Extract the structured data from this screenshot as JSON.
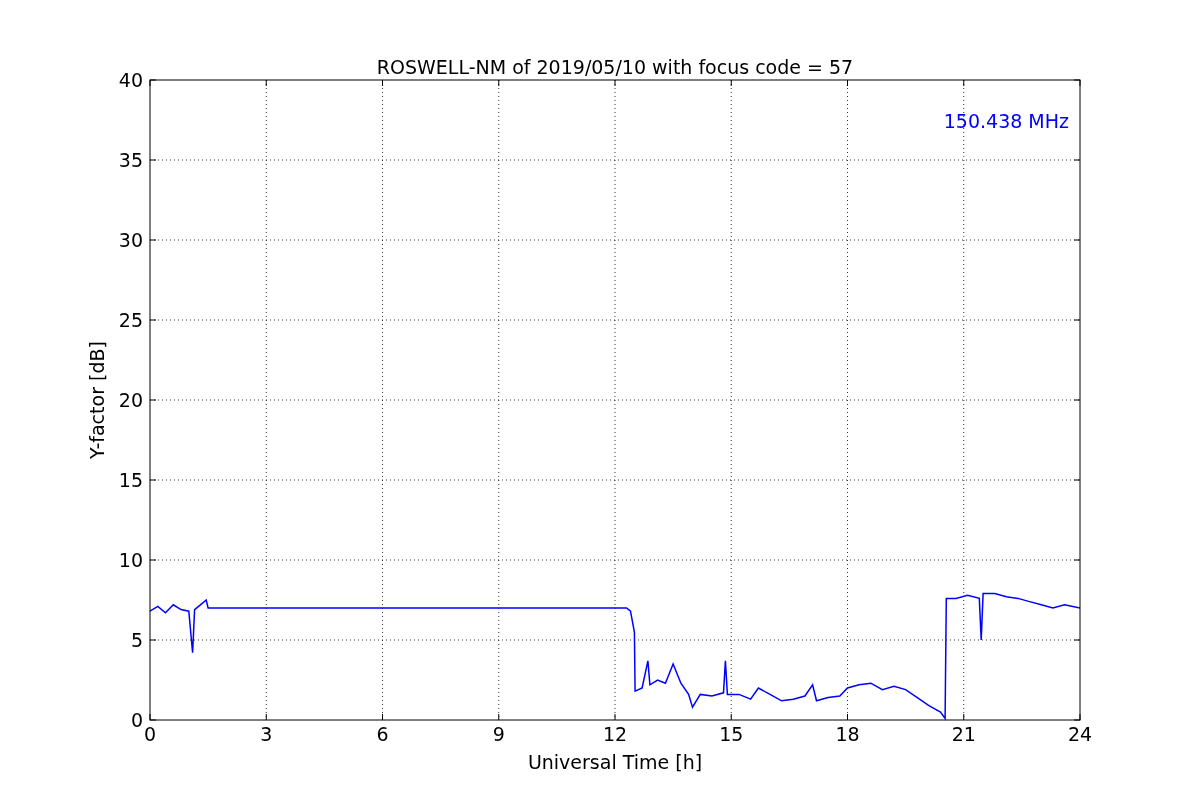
{
  "figure": {
    "chart_data": {
      "type": "line",
      "title": "ROSWELL-NM of 2019/05/10 with focus code = 57",
      "xlabel": "Universal Time [h]",
      "ylabel": "Y-factor [dB]",
      "xlim": [
        0,
        24
      ],
      "ylim": [
        0,
        40
      ],
      "xticks": [
        0,
        3,
        6,
        9,
        12,
        15,
        18,
        21,
        24
      ],
      "yticks": [
        0,
        5,
        10,
        15,
        20,
        25,
        30,
        35,
        40
      ],
      "x": [
        0,
        0.2,
        0.4,
        0.6,
        0.8,
        1.0,
        1.1,
        1.15,
        1.3,
        1.45,
        1.5,
        12.3,
        12.4,
        12.5,
        12.52,
        12.7,
        12.85,
        12.9,
        13.1,
        13.3,
        13.5,
        13.7,
        13.9,
        14.0,
        14.2,
        14.5,
        14.8,
        14.85,
        14.9,
        15.2,
        15.5,
        15.7,
        16.0,
        16.3,
        16.6,
        16.9,
        17.1,
        17.2,
        17.5,
        17.8,
        18.0,
        18.3,
        18.6,
        18.9,
        19.2,
        19.5,
        19.8,
        20.1,
        20.4,
        20.52,
        20.55,
        20.8,
        21.1,
        21.4,
        21.45,
        21.5,
        21.8,
        22.1,
        22.4,
        22.7,
        23.0,
        23.3,
        23.6,
        24
      ],
      "series": [
        {
          "name": "150.438 MHz",
          "color": "#0000ff",
          "values": [
            6.8,
            7.1,
            6.7,
            7.2,
            6.9,
            6.8,
            4.2,
            6.9,
            7.2,
            7.5,
            7.0,
            7.0,
            6.8,
            5.5,
            1.8,
            2.0,
            3.7,
            2.2,
            2.5,
            2.3,
            3.5,
            2.3,
            1.6,
            0.8,
            1.6,
            1.5,
            1.7,
            3.7,
            1.6,
            1.6,
            1.3,
            2.0,
            1.6,
            1.2,
            1.3,
            1.5,
            2.2,
            1.2,
            1.4,
            1.5,
            2.0,
            2.2,
            2.3,
            1.9,
            2.1,
            1.9,
            1.4,
            0.9,
            0.5,
            0.1,
            7.6,
            7.6,
            7.8,
            7.6,
            5.0,
            7.9,
            7.9,
            7.7,
            7.6,
            7.4,
            7.2,
            7.0,
            7.2,
            7.0
          ]
        }
      ],
      "grid": true
    }
  }
}
